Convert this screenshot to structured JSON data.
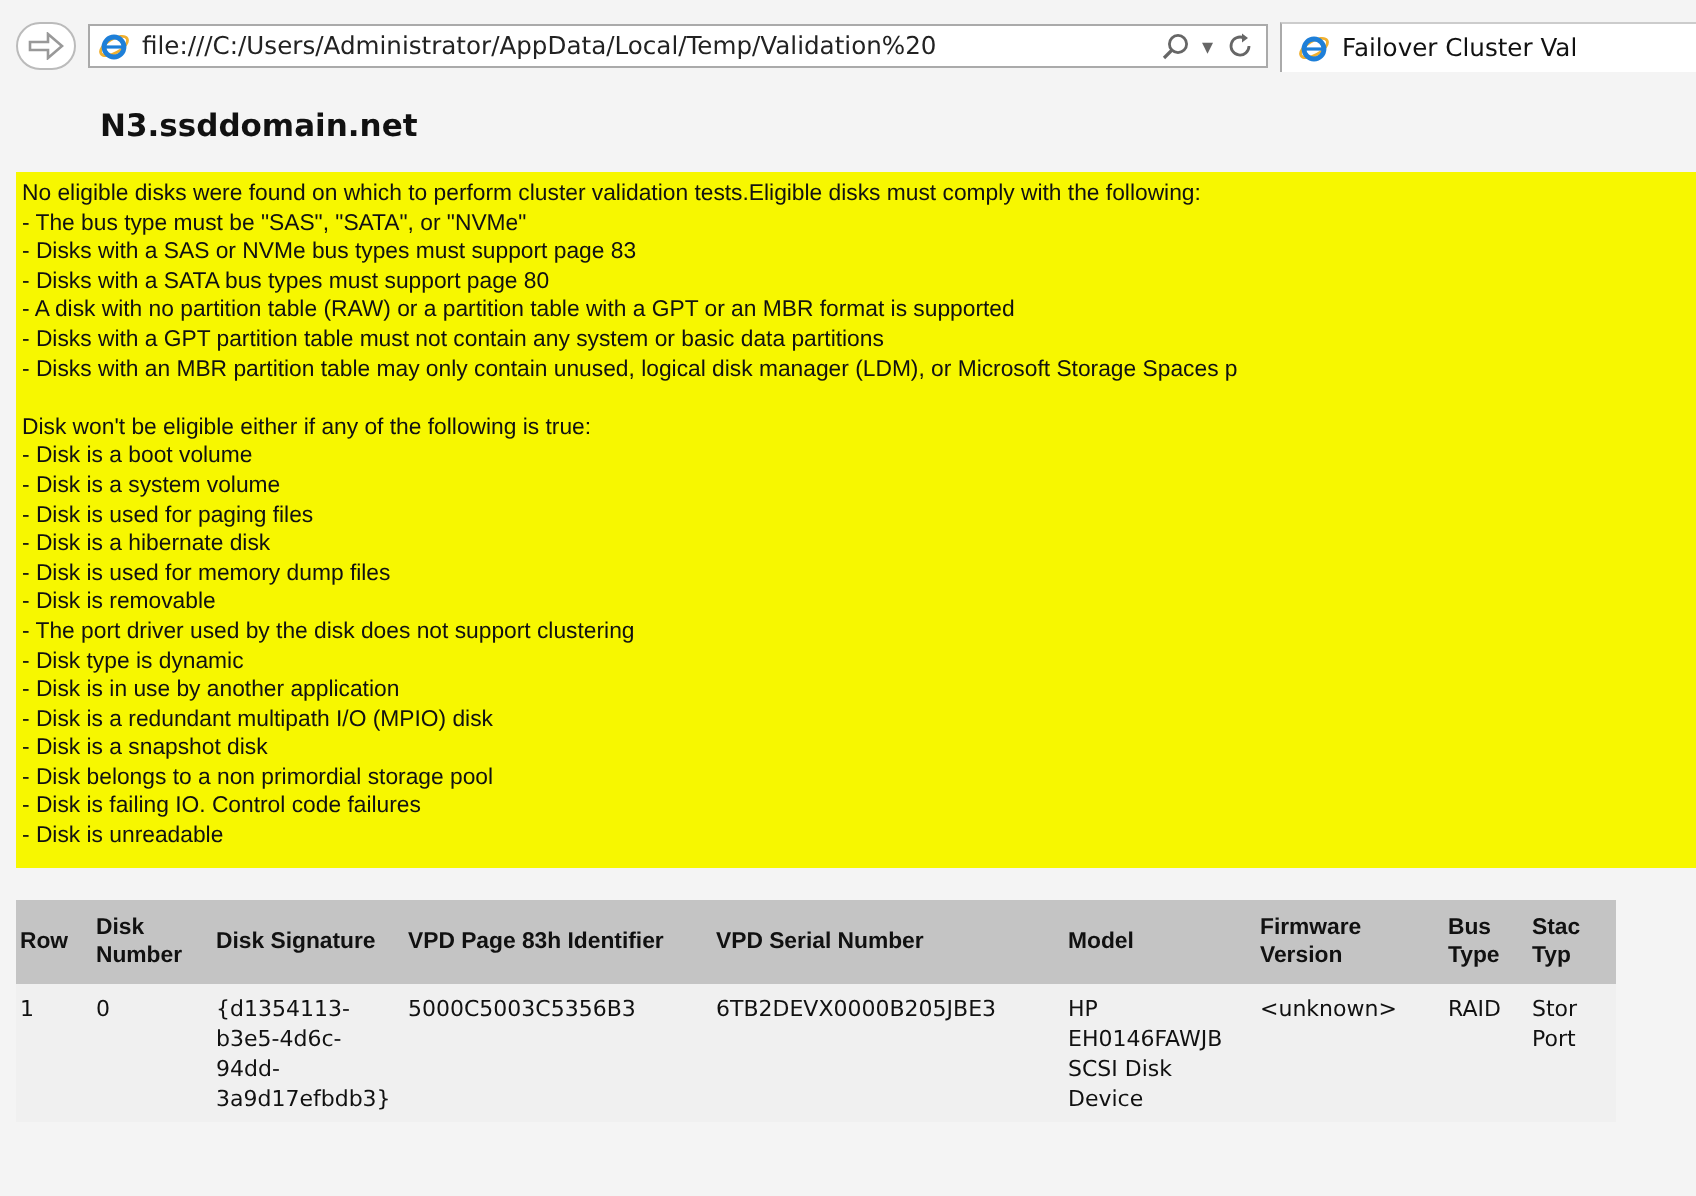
{
  "browser": {
    "address": "file:///C:/Users/Administrator/AppData/Local/Temp/Validation%20",
    "dropdown_glyph": "▾",
    "tab": {
      "label": "Failover Cluster Val",
      "selected": true
    }
  },
  "heading": "N3.ssddomain.net",
  "message": {
    "intro": "No eligible disks were found on which to perform cluster validation tests.Eligible disks must comply with the following:",
    "requirements": [
      "- The bus type must be \"SAS\", \"SATA\", or \"NVMe\"",
      "- Disks with a SAS or NVMe bus types must support page 83",
      "- Disks with a SATA bus types must support page 80",
      "- A disk with no partition table (RAW) or a partition table with a GPT or an MBR format is supported",
      "- Disks with a GPT partition table must not contain any system or basic data partitions",
      "- Disks with an MBR partition table may only contain unused, logical disk manager (LDM), or Microsoft Storage Spaces p"
    ],
    "exclusions_intro": "Disk won't be eligible either if any of the following is true:",
    "exclusions": [
      "- Disk is a boot volume",
      "- Disk is a system volume",
      "- Disk is used for paging files",
      "- Disk is a hibernate disk",
      "- Disk is used for memory dump files",
      "- Disk is removable",
      "- The port driver used by the disk does not support clustering",
      "- Disk type is dynamic",
      "- Disk is in use by another application",
      "- Disk is a redundant multipath I/O (MPIO) disk",
      "- Disk is a snapshot disk",
      "- Disk belongs to a non primordial storage pool",
      "- Disk is failing IO. Control code failures",
      "- Disk is unreadable"
    ]
  },
  "table": {
    "columns": [
      "Row",
      "Disk Number",
      "Disk Signature",
      "VPD Page 83h Identifier",
      "VPD Serial Number",
      "Model",
      "Firmware Version",
      "Bus Type",
      "Stac Typ"
    ],
    "rows": [
      [
        "1",
        "0",
        "{d1354113-b3e5-4d6c-94dd-3a9d17efbdb3}",
        "5000C5003C5356B3",
        "6TB2DEVX0000B205JBE3",
        "HP EH0146FAWJB SCSI Disk Device",
        "<unknown>",
        "RAID",
        "Stor Port"
      ]
    ]
  }
}
